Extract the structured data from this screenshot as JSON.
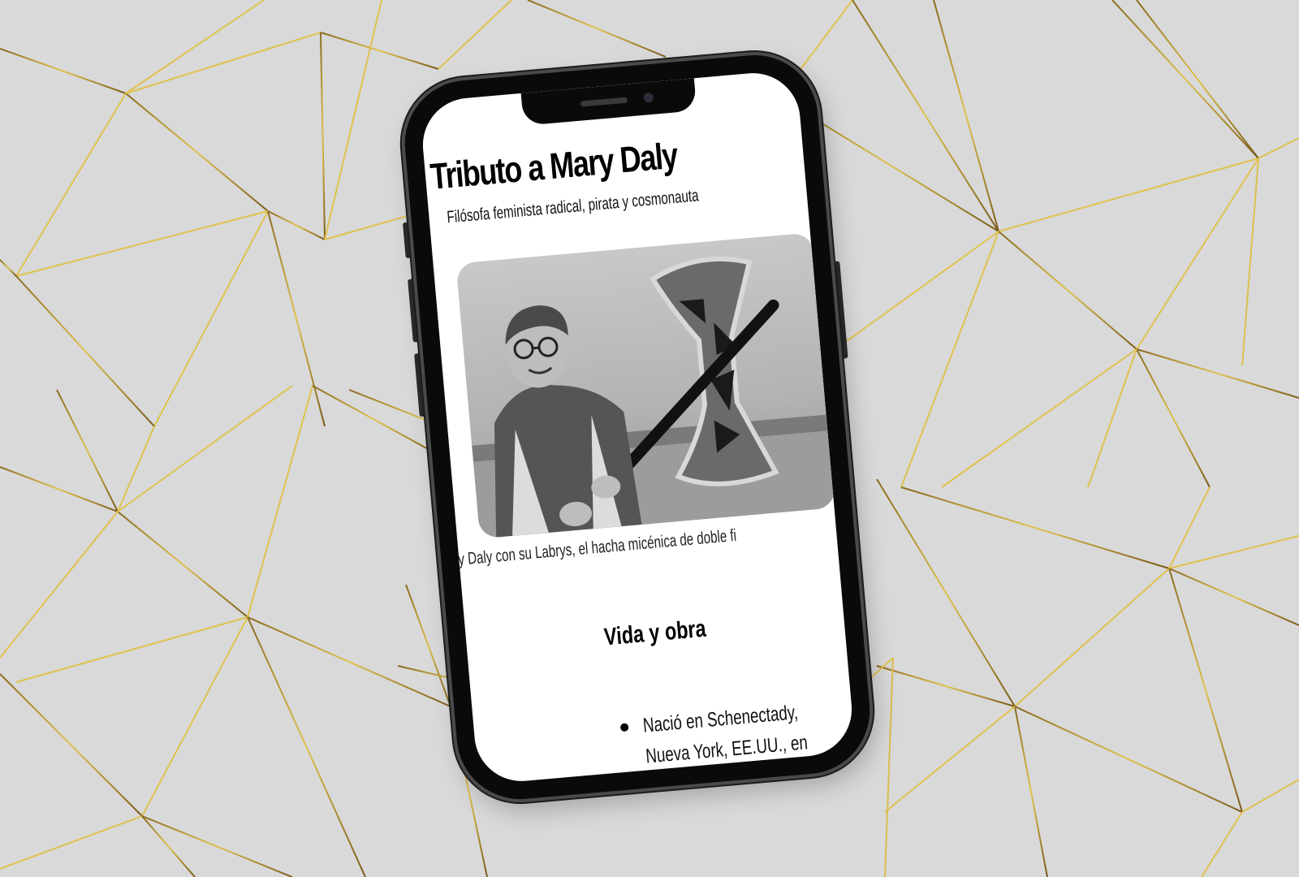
{
  "page": {
    "title": "Tributo a Mary Daly",
    "subtitle": "Filósofa feminista radical, pirata y cosmonauta",
    "image": {
      "description": "Black and white photo of Mary Daly holding a labrys on a beach",
      "caption": "ry Daly con su Labrys, el hacha micénica de doble fi"
    },
    "section": {
      "heading": "Vida y obra",
      "items": [
        {
          "lines": [
            "Nació en Schenectady,",
            "Nueva York, EE.UU., en"
          ]
        }
      ]
    }
  },
  "colors": {
    "background": "#d9d9d9",
    "gold_line": "#b89a3a",
    "phone_frame": "#0a0a0a",
    "screen": "#ffffff"
  }
}
